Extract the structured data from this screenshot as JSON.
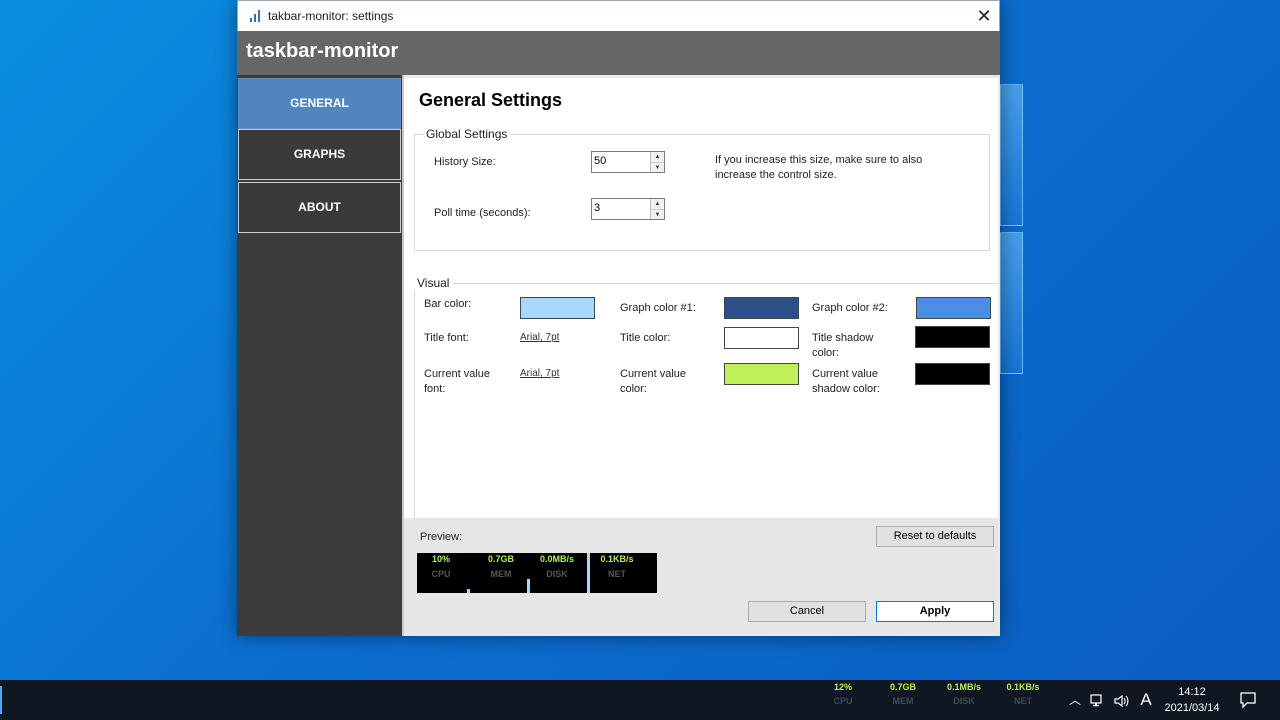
{
  "window": {
    "title": "takbar-monitor: settings",
    "close_glyph": "✕",
    "app_icon": "bar-chart-icon"
  },
  "header": {
    "brand": "taskbar-monitor"
  },
  "sidebar": {
    "items": [
      {
        "label": "GENERAL",
        "active": true
      },
      {
        "label": "GRAPHS",
        "active": false
      },
      {
        "label": "ABOUT",
        "active": false
      }
    ]
  },
  "general": {
    "title": "General Settings",
    "global": {
      "legend": "Global Settings",
      "history_label": "History Size:",
      "history_value": "50",
      "poll_label": "Poll time (seconds):",
      "poll_value": "3",
      "note": "If you increase this size, make sure to also increase the control size."
    },
    "visual": {
      "legend": "Visual",
      "bar_color_label": "Bar color:",
      "graph1_label": "Graph color #1:",
      "graph2_label": "Graph color #2:",
      "title_font_label": "Title font:",
      "title_font_value": "Arial, 7pt",
      "title_color_label": "Title color:",
      "title_shadow_label": "Title shadow color:",
      "current_font_label": "Current value font:",
      "current_font_value": "Arial, 7pt",
      "current_color_label": "Current value color:",
      "current_shadow_label": "Current value shadow color:",
      "colors": {
        "bar": "#a8d8ff",
        "graph1": "#2b4f86",
        "graph2": "#4a8ee6",
        "title": "#ffffff",
        "title_shadow": "#000000",
        "current_value": "#bff05a",
        "current_value_shadow": "#000000"
      }
    },
    "preview_label": "Preview:",
    "preview": [
      {
        "value": "10%",
        "title": "CPU"
      },
      {
        "value": "0.7GB",
        "title": "MEM"
      },
      {
        "value": "0.0MB/s",
        "title": "DISK"
      },
      {
        "value": "0.1KB/s",
        "title": "NET"
      }
    ],
    "reset_label": "Reset to defaults",
    "cancel_label": "Cancel",
    "apply_label": "Apply"
  },
  "taskbar": {
    "monitors": [
      {
        "value": "12%",
        "title": "CPU"
      },
      {
        "value": "0.7GB",
        "title": "MEM"
      },
      {
        "value": "0.1MB/s",
        "title": "DISK"
      },
      {
        "value": "0.1KB/s",
        "title": "NET"
      }
    ],
    "tray_icons": [
      "chevron-up-icon",
      "network-icon",
      "volume-icon",
      "ime-icon"
    ],
    "ime_label": "A",
    "time": "14:12",
    "date": "2021/03/14"
  }
}
